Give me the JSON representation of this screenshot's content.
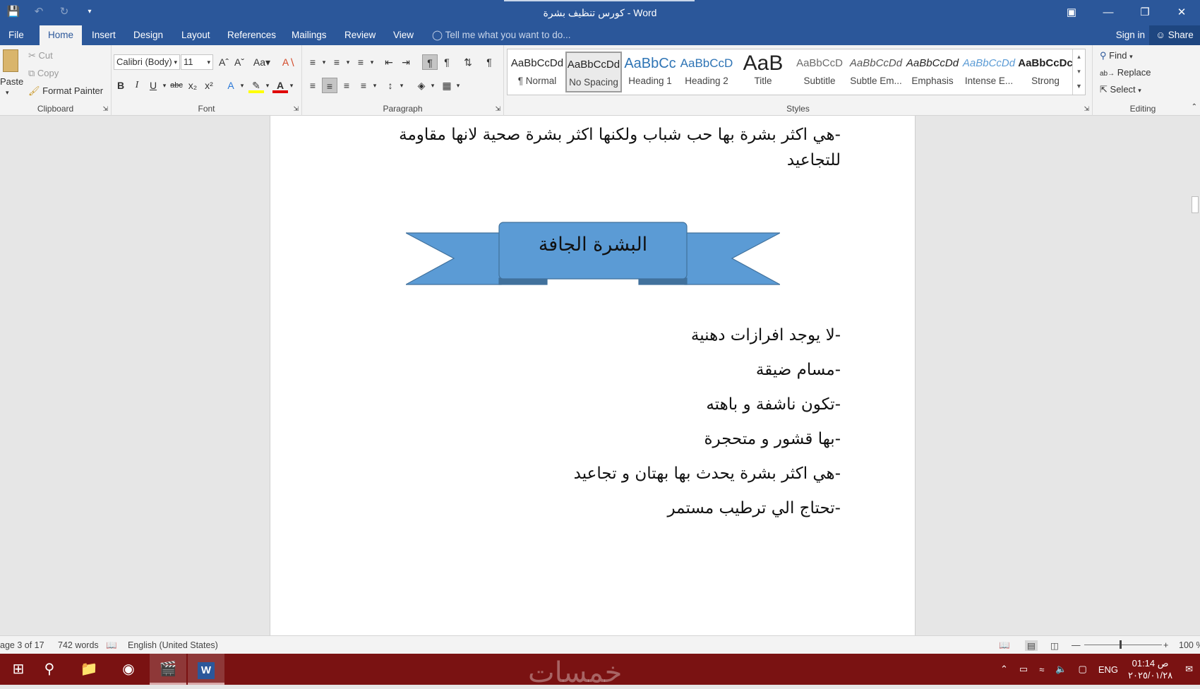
{
  "title_bar": {
    "title": "كورس تنظيف بشرة - Word",
    "controls": [
      "ribbon-display-icon",
      "minimize-icon",
      "restore-icon",
      "close-icon"
    ]
  },
  "quick_access": {
    "save": "save-icon",
    "undo": "undo-icon",
    "redo": "redo-icon",
    "customize": "customize-icon"
  },
  "tabs": [
    {
      "label": "File"
    },
    {
      "label": "Home",
      "active": true
    },
    {
      "label": "Insert"
    },
    {
      "label": "Design"
    },
    {
      "label": "Layout"
    },
    {
      "label": "References"
    },
    {
      "label": "Mailings"
    },
    {
      "label": "Review"
    },
    {
      "label": "View"
    }
  ],
  "tell_me": "Tell me what you want to do...",
  "sign_in": "Sign in",
  "share": "Share",
  "clipboard": {
    "label": "Clipboard",
    "paste": "Paste",
    "cut": "Cut",
    "copy": "Copy",
    "format_painter": "Format Painter"
  },
  "font": {
    "label": "Font",
    "family": "Calibri (Body)",
    "size": "11",
    "bold": "B",
    "italic": "I",
    "underline": "U",
    "strike": "abc",
    "change_case": "Aa"
  },
  "paragraph": {
    "label": "Paragraph"
  },
  "styles": {
    "label": "Styles",
    "items": [
      {
        "preview": "AaBbCcDd",
        "name": "¶ Normal"
      },
      {
        "preview": "AaBbCcDd",
        "name": "No Spacing",
        "selected": true
      },
      {
        "preview": "AaBbCc",
        "name": "Heading 1"
      },
      {
        "preview": "AaBbCcD",
        "name": "Heading 2"
      },
      {
        "preview": "AaB",
        "name": "Title"
      },
      {
        "preview": "AaBbCcD",
        "name": "Subtitle"
      },
      {
        "preview": "AaBbCcDd",
        "name": "Subtle Em..."
      },
      {
        "preview": "AaBbCcDd",
        "name": "Emphasis"
      },
      {
        "preview": "AaBbCcDd",
        "name": "Intense E..."
      },
      {
        "preview": "AaBbCcDc",
        "name": "Strong"
      }
    ]
  },
  "editing": {
    "label": "Editing",
    "find": "Find",
    "replace": "Replace",
    "select": "Select"
  },
  "document": {
    "top_line1": "-هي اكثر بشرة بها حب شباب ولكنها اكثر بشرة صحية لانها مقاومة",
    "top_line2": "للتجاعيد",
    "banner_text": "البشرة الجافة",
    "banner_color": "#5b9bd5",
    "bullets": [
      "-لا يوجد افرازات دهنية",
      "-مسام ضيقة",
      "-تكون ناشفة و باهته",
      "-بها قشور و متحجرة",
      "-هي اكثر بشرة يحدث بها بهتان و تجاعيد",
      "-تحتاج الي ترطيب مستمر"
    ]
  },
  "status_bar": {
    "page": "age 3 of 17",
    "words": "742 words",
    "language": "English (United States)",
    "zoom": "100 %"
  },
  "taskbar": {
    "watermark": "خمسات",
    "language": "ENG",
    "time": "01:14 ص",
    "date": "٢٠٢٥/٠١/٢٨",
    "apps": [
      "windows-start-icon",
      "search-icon",
      "file-explorer-icon",
      "chrome-icon",
      "video-editor-icon",
      "word-icon"
    ]
  }
}
